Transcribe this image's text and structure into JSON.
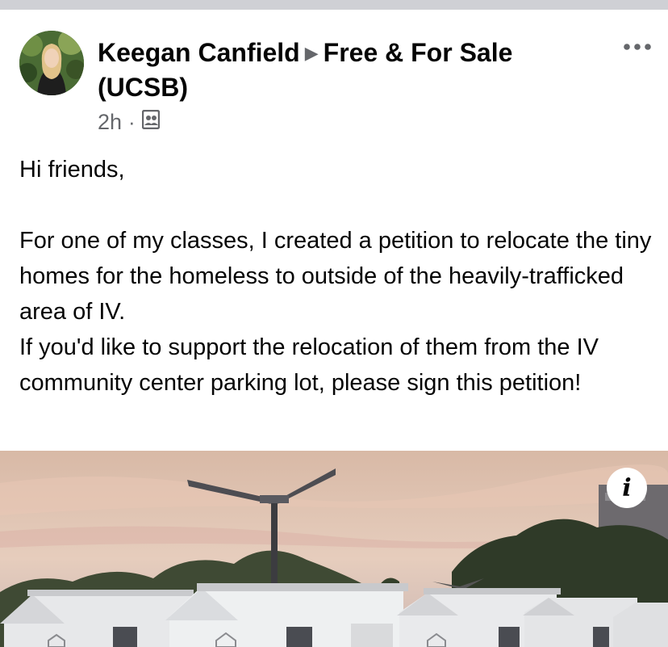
{
  "post": {
    "author": "Keegan Canfield",
    "group": "Free & For Sale (UCSB)",
    "time": "2h",
    "dot": "·",
    "audience_icon": "group-members-icon",
    "more_icon": "more-horizontal-icon",
    "body": [
      "Hi friends,",
      "",
      "For one of my classes, I created a petition to relocate the tiny homes for the homeless to outside of the heavily-trafficked area of IV.",
      "If you'd like to support the relocation of them from the IV community center parking lot, please sign this petition!"
    ],
    "info_label": "i"
  },
  "colors": {
    "divider": "#cfd0d5",
    "meta_text": "#65676b",
    "text": "#050505"
  }
}
